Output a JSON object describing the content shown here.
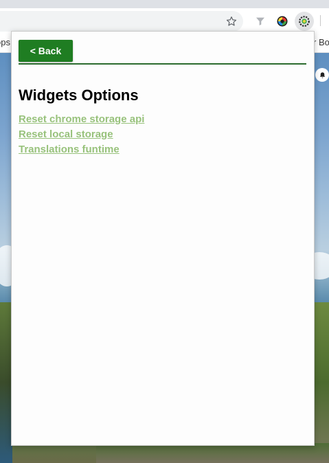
{
  "browser": {
    "bookmarks_left_text": "ops",
    "bookmarks_right_text": "r Bo",
    "extension_icons": [
      "star-icon",
      "filter-icon",
      "color-wheel-icon",
      "widget-gear-icon"
    ]
  },
  "popup": {
    "back_label": "< Back",
    "title": "Widgets Options",
    "links": [
      "Reset chrome storage api",
      "Reset local storage",
      "Translations funtime"
    ],
    "accent_color": "#1f7d22",
    "link_color": "#98c27c"
  },
  "page": {
    "notification_icon": "bell-icon"
  }
}
